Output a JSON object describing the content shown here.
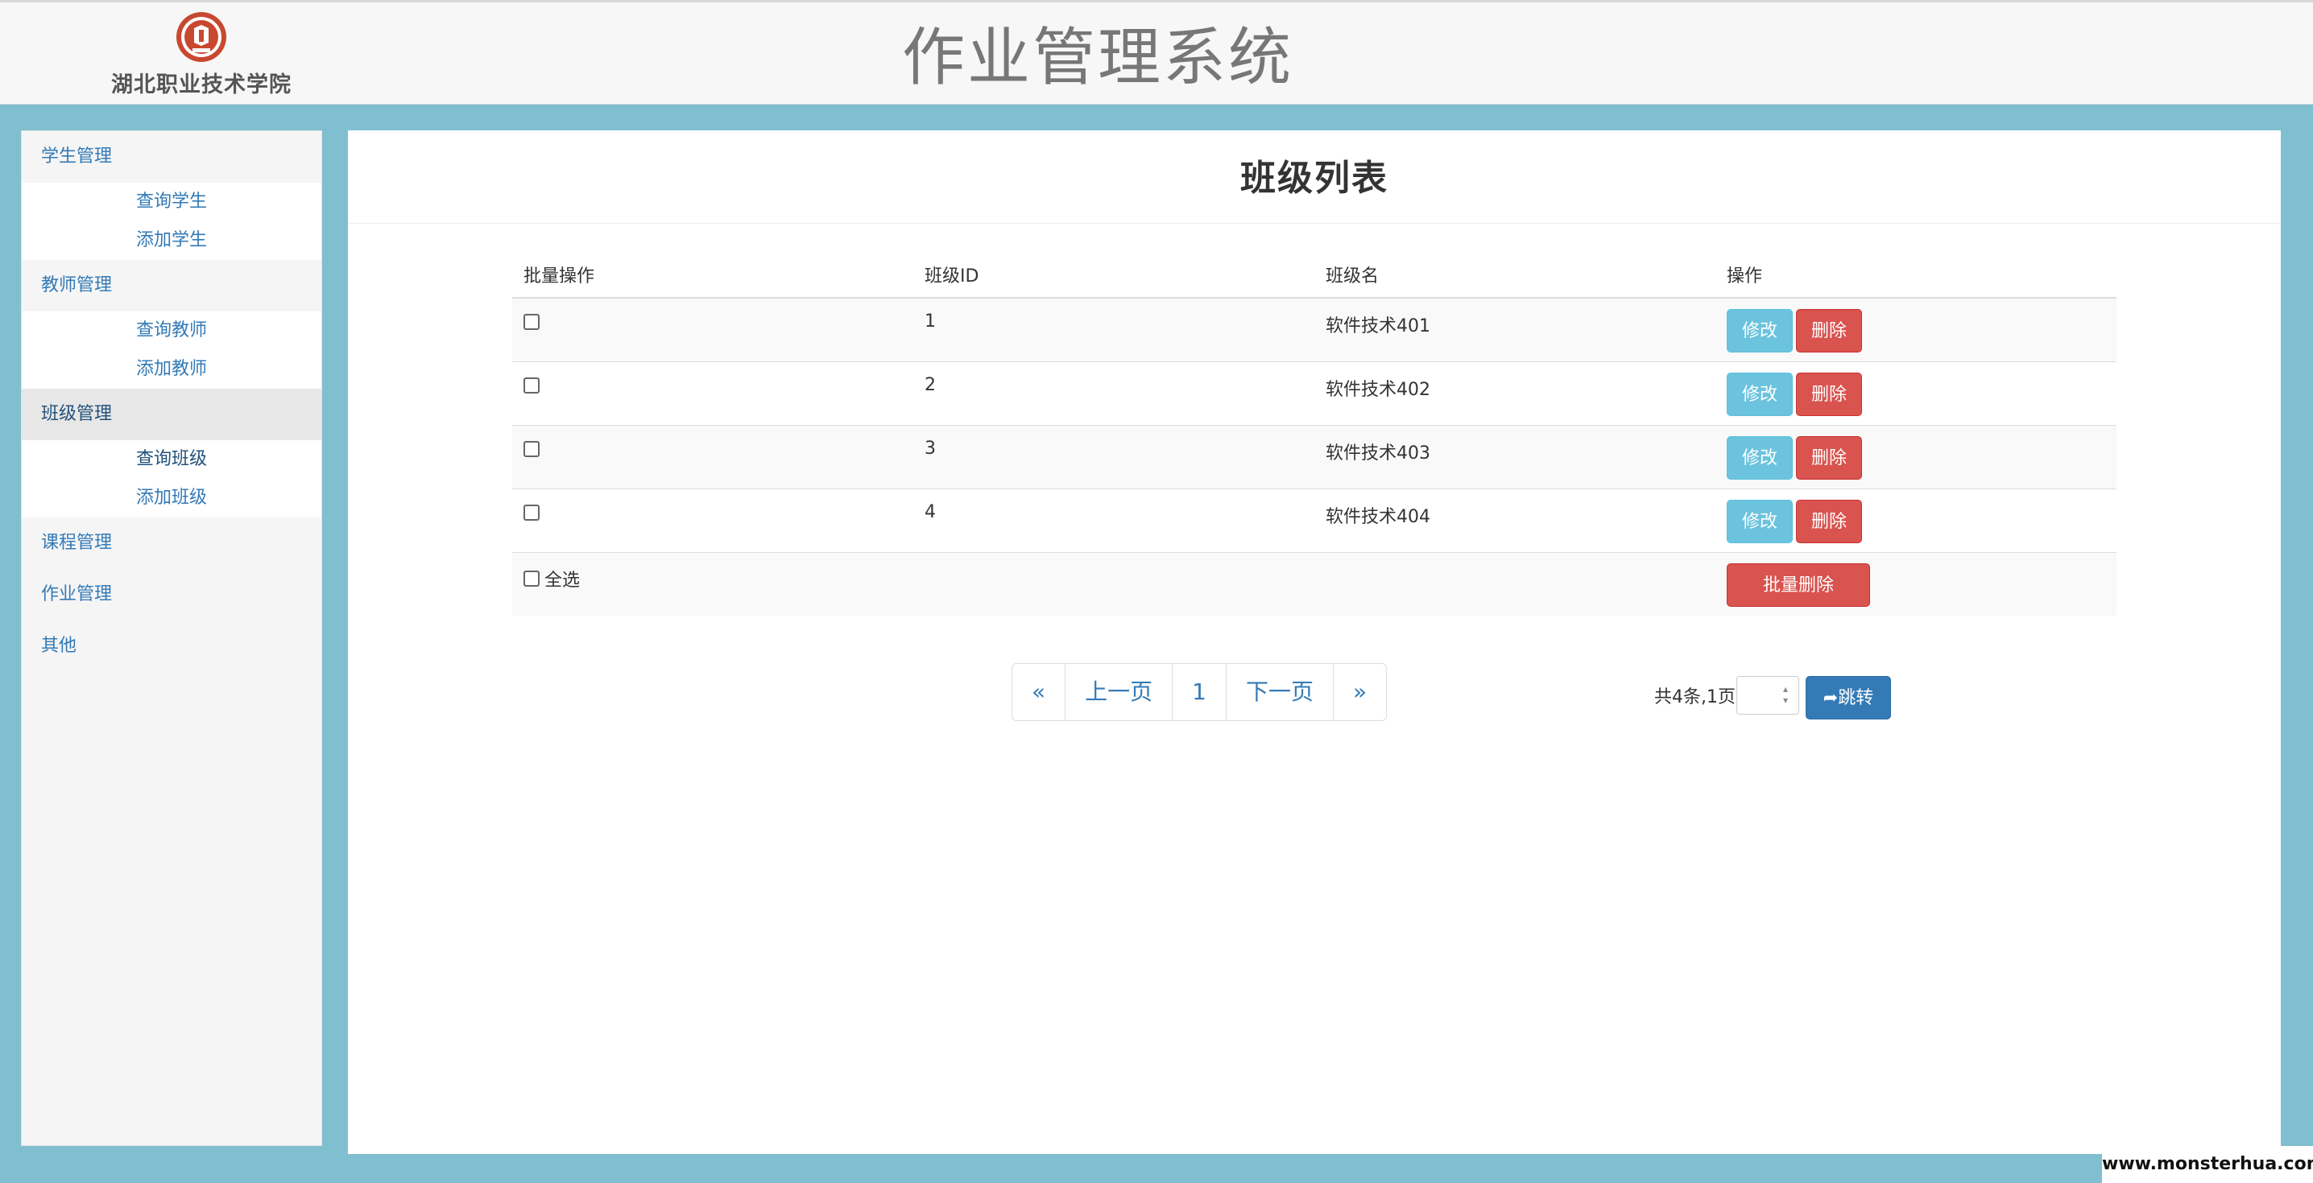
{
  "header": {
    "school_name": "湖北职业技术学院",
    "system_title": "作业管理系统",
    "logo_icon": "school-seal-icon",
    "logo_color": "#c8482f"
  },
  "sidebar": {
    "groups": [
      {
        "label": "学生管理",
        "items": [
          "查询学生",
          "添加学生"
        ]
      },
      {
        "label": "教师管理",
        "items": [
          "查询教师",
          "添加教师"
        ]
      },
      {
        "label": "班级管理",
        "items": [
          "查询班级",
          "添加班级"
        ],
        "active": true
      },
      {
        "label": "课程管理",
        "items": []
      },
      {
        "label": "作业管理",
        "items": []
      },
      {
        "label": "其他",
        "items": []
      }
    ]
  },
  "main": {
    "title": "班级列表",
    "table": {
      "headers": [
        "批量操作",
        "班级ID",
        "班级名",
        "操作"
      ],
      "rows": [
        {
          "id": "1",
          "name": "软件技术401"
        },
        {
          "id": "2",
          "name": "软件技术402"
        },
        {
          "id": "3",
          "name": "软件技术403"
        },
        {
          "id": "4",
          "name": "软件技术404"
        }
      ],
      "edit_label": "修改",
      "delete_label": "删除",
      "select_all_label": "全选",
      "batch_delete_label": "批量删除"
    },
    "pagination": {
      "first": "«",
      "prev": "上一页",
      "current": "1",
      "next": "下一页",
      "last": "»",
      "info": "共4条,1页",
      "jump_label": "跳转",
      "jump_icon": "share-arrow-icon"
    }
  },
  "watermark": "www.monsterhua.com",
  "colors": {
    "background": "#7fbfcf",
    "link": "#337ab7",
    "edit_button": "#6cc3de",
    "delete_button": "#d9534f",
    "jump_button": "#337ab7"
  }
}
